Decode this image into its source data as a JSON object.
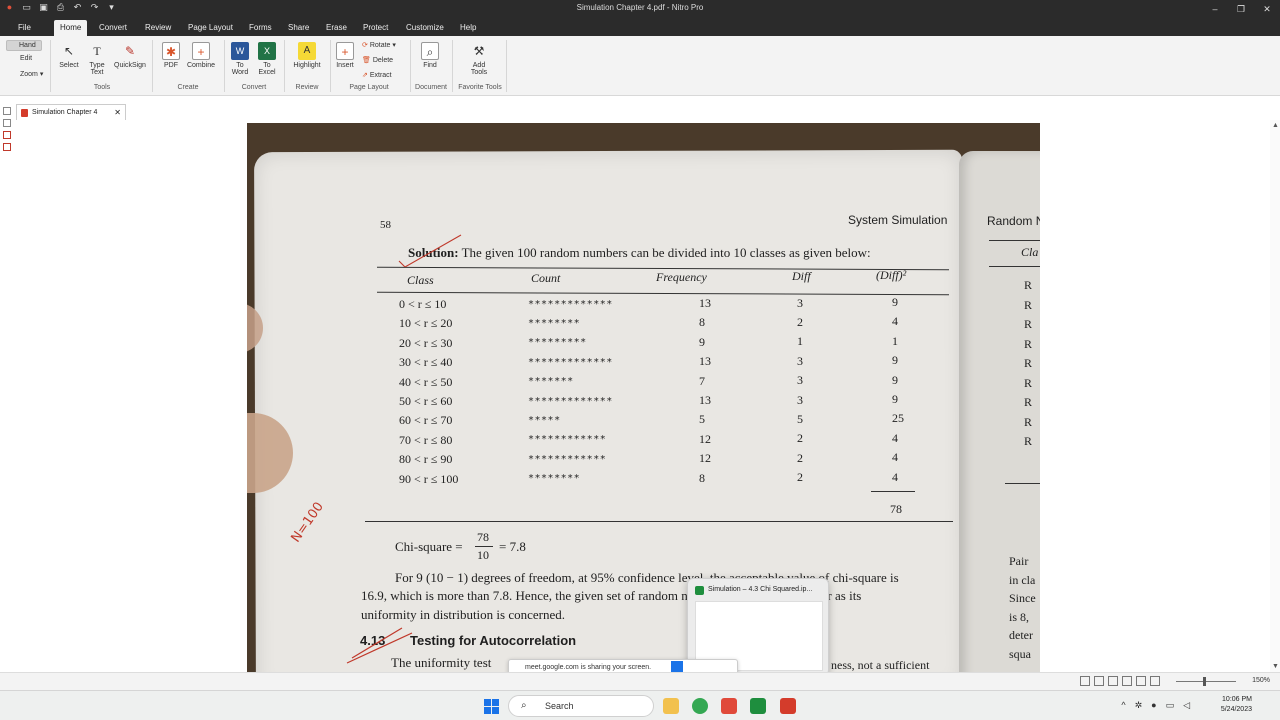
{
  "window": {
    "title": "Simulation Chapter 4.pdf - Nitro Pro"
  },
  "menu": {
    "tabs": [
      "File",
      "Home",
      "Convert",
      "Review",
      "Page Layout",
      "Forms",
      "Share",
      "Erase",
      "Protect",
      "Customize",
      "Help"
    ],
    "active": "Home"
  },
  "ribbon": {
    "hand": "Hand",
    "edit": "Edit",
    "zoom": "Zoom",
    "select": "Select",
    "type_text": "Type\nText",
    "quicksign": "QuickSign",
    "pdf": "PDF",
    "combine": "Combine",
    "to_word": "To\nWord",
    "to_excel": "To\nExcel",
    "highlight": "Highlight",
    "insert": "Insert",
    "rotate": "Rotate",
    "delete": "Delete",
    "extract": "Extract",
    "find": "Find",
    "add_tools": "Add\nTools",
    "groups": {
      "tools": "Tools",
      "create": "Create",
      "convert": "Convert",
      "review": "Review",
      "page_layout": "Page Layout",
      "document": "Document",
      "favorite_tools": "Favorite Tools"
    }
  },
  "doc_tab": {
    "label": "Simulation Chapter 4"
  },
  "page": {
    "page_number": "58",
    "running_head": "System Simulation",
    "solution_label": "Solution:",
    "solution_text": "The given 100 random numbers can be divided into 10 classes as given below:",
    "table": {
      "headers": [
        "Class",
        "Count",
        "Frequency",
        "Diff",
        "(Diff)²"
      ],
      "rows": [
        [
          "0 < r ≤ 10",
          "*************",
          "13",
          "3",
          "9"
        ],
        [
          "10 < r ≤ 20",
          "********",
          "8",
          "2",
          "4"
        ],
        [
          "20 < r ≤ 30",
          "*********",
          "9",
          "1",
          "1"
        ],
        [
          "30 < r ≤ 40",
          "*************",
          "13",
          "3",
          "9"
        ],
        [
          "40 < r ≤ 50",
          "*******",
          "7",
          "3",
          "9"
        ],
        [
          "50 < r ≤ 60",
          "*************",
          "13",
          "3",
          "9"
        ],
        [
          "60 < r ≤ 70",
          "*****",
          "5",
          "5",
          "25"
        ],
        [
          "70 < r ≤ 80",
          "************",
          "12",
          "2",
          "4"
        ],
        [
          "80 < r ≤ 90",
          "************",
          "12",
          "2",
          "4"
        ],
        [
          "90 < r ≤ 100",
          "********",
          "8",
          "2",
          "4"
        ]
      ],
      "total": "78"
    },
    "chi_square_label": "Chi-square =",
    "chi_num": "78",
    "chi_den": "10",
    "chi_result": "= 7.8",
    "para1_line1": "For 9 (10 − 1) degrees of freedom, at 95% confidence level, the acceptable value of chi-square is",
    "para1_line2": "16.9, which is more than 7.8. Hence, the given set of random numbers is acceptable, so far as its",
    "para1_line3": "uniformity in distribution is concerned.",
    "section_number": "4.13",
    "section_title": "Testing for Autocorrelation",
    "para2_line1": "The uniformity test",
    "para2_tail": "ness, not a sufficient",
    "handwriting": "N=100",
    "right_page_head": "Random N",
    "right_page_lines": [
      "Cla",
      "R",
      "R",
      "R",
      "R",
      "R",
      "R",
      "R",
      "R",
      "R"
    ],
    "right_page_bottom": [
      "Pair",
      "in cla",
      "Since",
      "is 8,",
      "deter",
      "squa"
    ]
  },
  "popup": {
    "title": "Simulation – 4.3 Chi Squared.ip..."
  },
  "sharing_bar": {
    "text": "meet.google.com is sharing your screen."
  },
  "status": {
    "zoom": "150%"
  },
  "taskbar": {
    "search": "Search",
    "time": "10:06 PM",
    "date": "5/24/2023"
  }
}
